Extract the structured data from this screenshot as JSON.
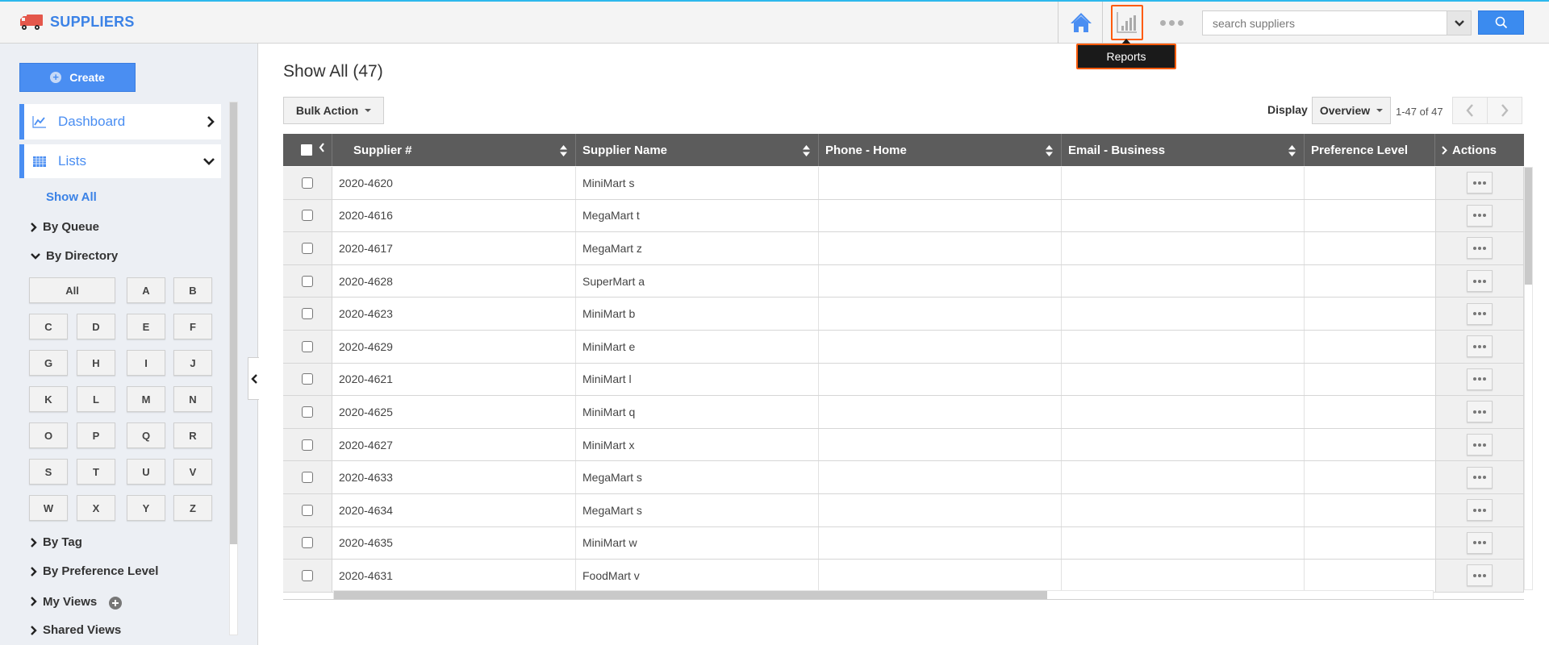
{
  "app": {
    "title": "SUPPLIERS",
    "logo_icon": "truck-icon"
  },
  "header": {
    "home_icon": "home-icon",
    "reports_icon": "bar-chart-icon",
    "more_icon": "more-dots-icon",
    "search": {
      "placeholder": "search suppliers",
      "value": ""
    },
    "tooltip": "Reports",
    "accent_color": "#ff5b0a",
    "brand_color": "#3b82e6"
  },
  "sidebar": {
    "create_label": "Create",
    "nav": [
      {
        "label": "Dashboard",
        "icon": "line-chart-icon",
        "expanded": false
      },
      {
        "label": "Lists",
        "icon": "table-grid-icon",
        "expanded": true
      }
    ],
    "show_all": "Show All",
    "tree": {
      "by_queue": "By Queue",
      "by_directory": "By Directory",
      "by_tag": "By Tag",
      "by_preference": "By Preference Level",
      "my_views": "My Views",
      "shared_views": "Shared Views"
    },
    "directory": [
      "All",
      "A",
      "B",
      "C",
      "D",
      "E",
      "F",
      "G",
      "H",
      "I",
      "J",
      "K",
      "L",
      "M",
      "N",
      "O",
      "P",
      "Q",
      "R",
      "S",
      "T",
      "U",
      "V",
      "W",
      "X",
      "Y",
      "Z"
    ]
  },
  "main": {
    "title": "Show All (47)",
    "bulk_action": "Bulk Action",
    "display_label": "Display",
    "display_value": "Overview",
    "pager": "1-47 of 47",
    "columns": [
      "Supplier #",
      "Supplier Name",
      "Phone - Home",
      "Email - Business",
      "Preference Level",
      "Actions"
    ],
    "rows": [
      {
        "id": "2020-4620",
        "name": "MiniMart s",
        "phone": "",
        "email": "",
        "pref": ""
      },
      {
        "id": "2020-4616",
        "name": "MegaMart t",
        "phone": "",
        "email": "",
        "pref": ""
      },
      {
        "id": "2020-4617",
        "name": "MegaMart z",
        "phone": "",
        "email": "",
        "pref": ""
      },
      {
        "id": "2020-4628",
        "name": "SuperMart a",
        "phone": "",
        "email": "",
        "pref": ""
      },
      {
        "id": "2020-4623",
        "name": "MiniMart b",
        "phone": "",
        "email": "",
        "pref": ""
      },
      {
        "id": "2020-4629",
        "name": "MiniMart e",
        "phone": "",
        "email": "",
        "pref": ""
      },
      {
        "id": "2020-4621",
        "name": "MiniMart l",
        "phone": "",
        "email": "",
        "pref": ""
      },
      {
        "id": "2020-4625",
        "name": "MiniMart q",
        "phone": "",
        "email": "",
        "pref": ""
      },
      {
        "id": "2020-4627",
        "name": "MiniMart x",
        "phone": "",
        "email": "",
        "pref": ""
      },
      {
        "id": "2020-4633",
        "name": "MegaMart s",
        "phone": "",
        "email": "",
        "pref": ""
      },
      {
        "id": "2020-4634",
        "name": "MegaMart s",
        "phone": "",
        "email": "",
        "pref": ""
      },
      {
        "id": "2020-4635",
        "name": "MiniMart w",
        "phone": "",
        "email": "",
        "pref": ""
      },
      {
        "id": "2020-4631",
        "name": "FoodMart v",
        "phone": "",
        "email": "",
        "pref": ""
      }
    ]
  }
}
